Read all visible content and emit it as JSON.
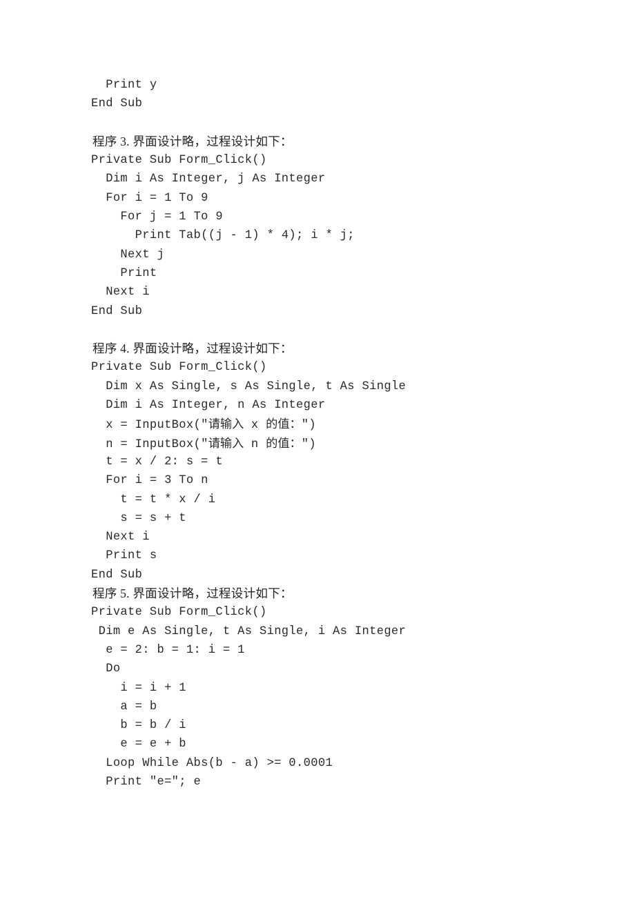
{
  "document": {
    "type": "scanned-exercise-page",
    "language": "Visual Basic",
    "text_color": "#2b2b2b",
    "background_color": "#ffffff"
  },
  "blocks": [
    {
      "id": "program-2-tail",
      "kind": "code",
      "lines": [
        "  Print y",
        "End Sub"
      ]
    },
    {
      "id": "gap-1",
      "kind": "blank",
      "lines": [
        ""
      ]
    },
    {
      "id": "program-3-heading",
      "kind": "heading",
      "text": "程序 3. 界面设计略，过程设计如下："
    },
    {
      "id": "program-3-code",
      "kind": "code",
      "lines": [
        "Private Sub Form_Click()",
        "  Dim i As Integer, j As Integer",
        "  For i = 1 To 9",
        "    For j = 1 To 9",
        "      Print Tab((j - 1) * 4); i * j;",
        "    Next j",
        "    Print",
        "  Next i",
        "End Sub"
      ]
    },
    {
      "id": "gap-2",
      "kind": "blank",
      "lines": [
        ""
      ]
    },
    {
      "id": "program-4-heading",
      "kind": "heading",
      "text": "程序 4. 界面设计略，过程设计如下："
    },
    {
      "id": "program-4-code",
      "kind": "code",
      "lines": [
        "Private Sub Form_Click()",
        "  Dim x As Single, s As Single, t As Single",
        "  Dim i As Integer, n As Integer",
        "  x = InputBox(\"请输入 x 的值：\")",
        "  n = InputBox(\"请输入 n 的值：\")",
        "  t = x / 2: s = t",
        "  For i = 3 To n",
        "    t = t * x / i",
        "    s = s + t",
        "  Next i",
        "  Print s",
        "End Sub"
      ]
    },
    {
      "id": "program-5-heading",
      "kind": "heading",
      "text": "程序 5. 界面设计略，过程设计如下："
    },
    {
      "id": "program-5-code",
      "kind": "code",
      "lines": [
        "Private Sub Form_Click()",
        " Dim e As Single, t As Single, i As Integer",
        "  e = 2: b = 1: i = 1",
        "  Do",
        "    i = i + 1",
        "    a = b",
        "    b = b / i",
        "    e = e + b",
        "  Loop While Abs(b - a) >= 0.0001",
        "  Print \"e=\"; e"
      ]
    }
  ]
}
